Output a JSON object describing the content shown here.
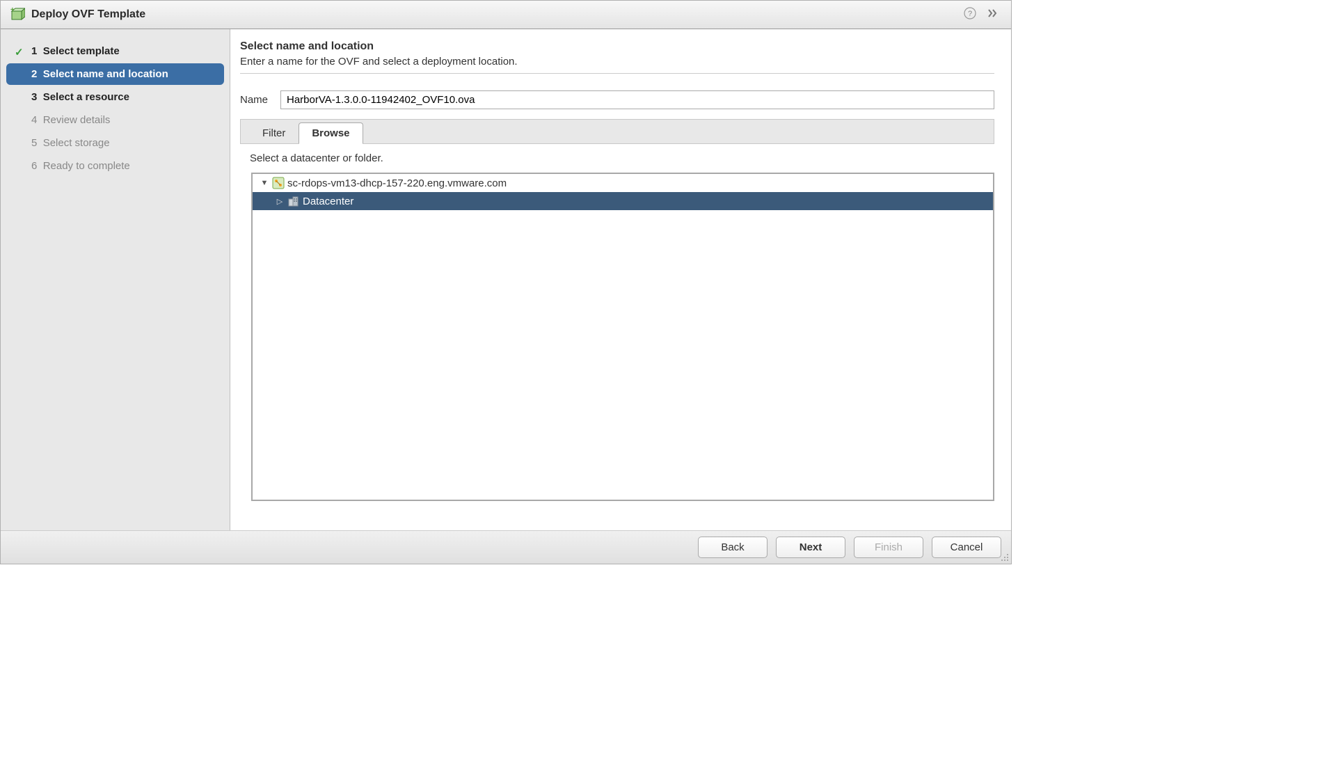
{
  "dialog": {
    "title": "Deploy OVF Template"
  },
  "steps": [
    {
      "num": "1",
      "label": "Select template",
      "state": "completed"
    },
    {
      "num": "2",
      "label": "Select name and location",
      "state": "active"
    },
    {
      "num": "3",
      "label": "Select a resource",
      "state": "future-enabled"
    },
    {
      "num": "4",
      "label": "Review details",
      "state": "future-disabled"
    },
    {
      "num": "5",
      "label": "Select storage",
      "state": "future-disabled"
    },
    {
      "num": "6",
      "label": "Ready to complete",
      "state": "future-disabled"
    }
  ],
  "main": {
    "heading": "Select name and location",
    "description": "Enter a name for the OVF and select a deployment location.",
    "name_label": "Name",
    "name_value": "HarborVA-1.3.0.0-11942402_OVF10.ova",
    "tabs": {
      "filter": "Filter",
      "browse": "Browse",
      "active": "browse"
    },
    "tab_instruction": "Select a datacenter or folder.",
    "tree": {
      "host": "sc-rdops-vm13-dhcp-157-220.eng.vmware.com",
      "datacenter": "Datacenter"
    }
  },
  "footer": {
    "back": "Back",
    "next": "Next",
    "finish": "Finish",
    "cancel": "Cancel"
  }
}
